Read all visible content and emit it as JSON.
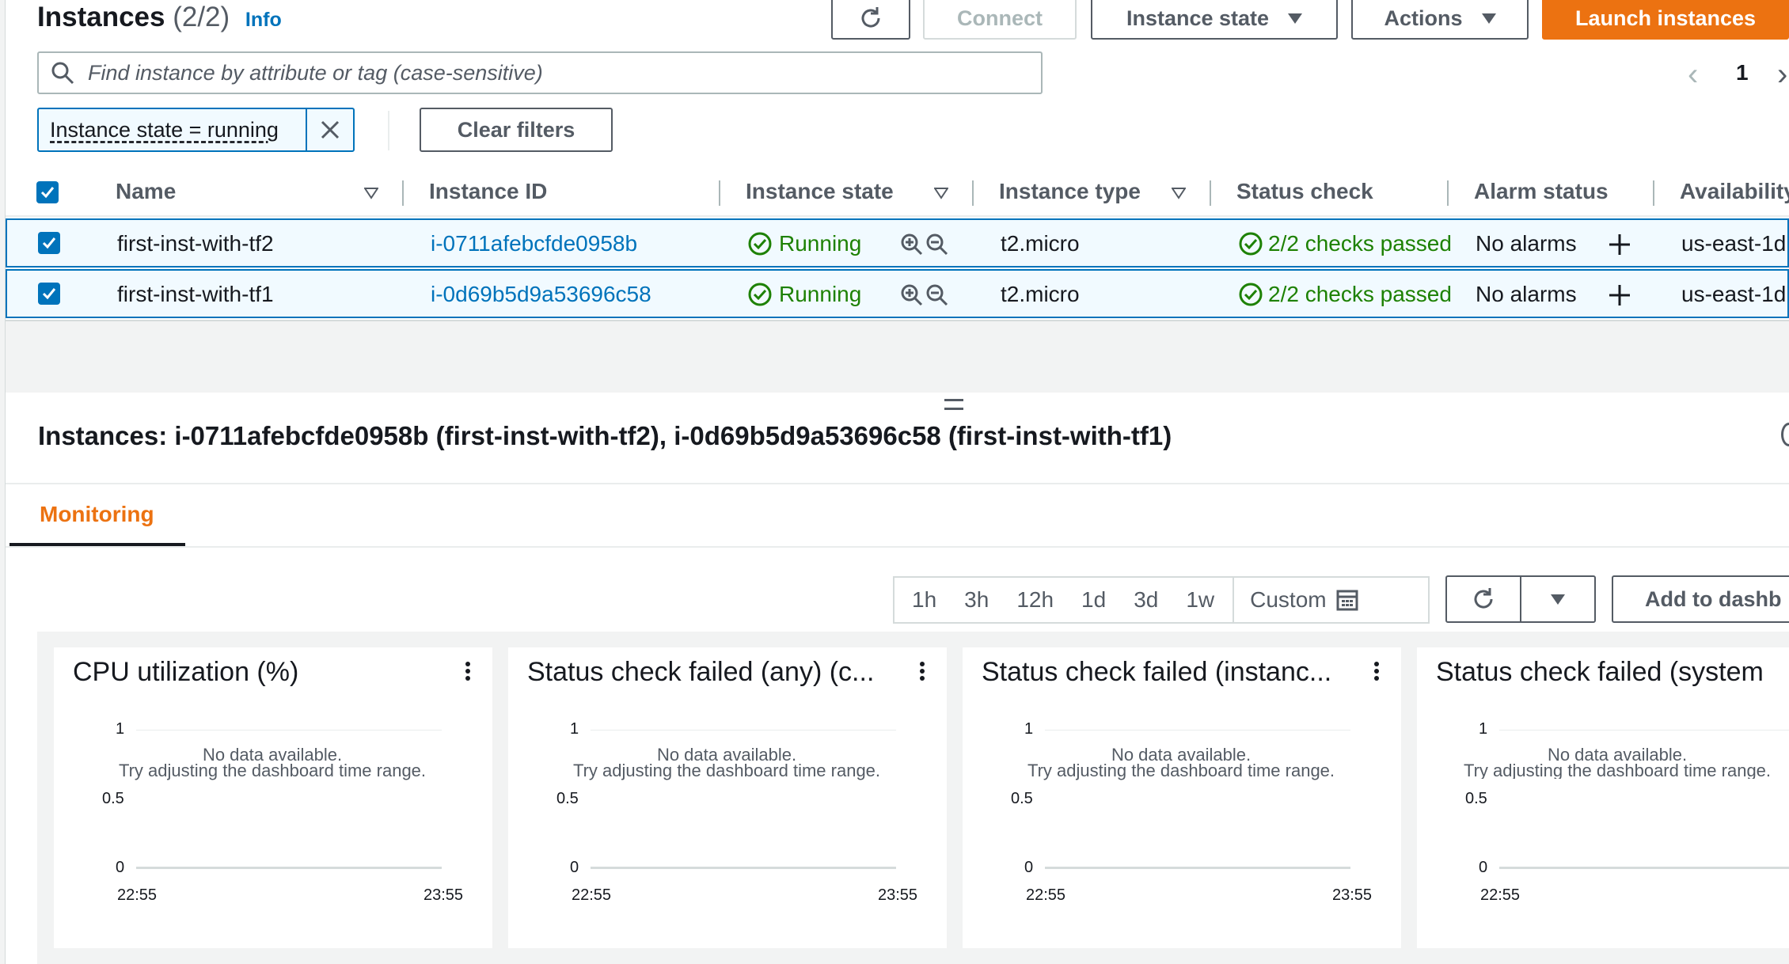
{
  "header": {
    "title": "Instances",
    "count": "(2/2)",
    "info": "Info",
    "refresh_icon": "refresh-icon",
    "connect": "Connect",
    "instance_state": "Instance state",
    "actions": "Actions",
    "launch": "Launch instances"
  },
  "search": {
    "placeholder": "Find instance by attribute or tag (case-sensitive)"
  },
  "pagination": {
    "page": "1"
  },
  "filters": {
    "token": "Instance state = running",
    "clear": "Clear filters"
  },
  "table": {
    "columns": [
      "Name",
      "Instance ID",
      "Instance state",
      "Instance type",
      "Status check",
      "Alarm status",
      "Availability"
    ],
    "rows": [
      {
        "name": "first-inst-with-tf2",
        "id": "i-0711afebcfde0958b",
        "state": "Running",
        "type": "t2.micro",
        "status": "2/2 checks passed",
        "alarm": "No alarms",
        "az": "us-east-1d"
      },
      {
        "name": "first-inst-with-tf1",
        "id": "i-0d69b5d9a53696c58",
        "state": "Running",
        "type": "t2.micro",
        "status": "2/2 checks passed",
        "alarm": "No alarms",
        "az": "us-east-1d"
      }
    ]
  },
  "details": {
    "title": "Instances: i-0711afebcfde0958b (first-inst-with-tf2), i-0d69b5d9a53696c58 (first-inst-with-tf1)",
    "tab": "Monitoring"
  },
  "monitoring": {
    "ranges": [
      "1h",
      "3h",
      "12h",
      "1d",
      "3d",
      "1w"
    ],
    "custom": "Custom",
    "add_dashboard": "Add to dashb",
    "widgets": [
      {
        "title": "CPU utilization (%)"
      },
      {
        "title": "Status check failed (any) (c..."
      },
      {
        "title": "Status check failed (instanc..."
      },
      {
        "title": "Status check failed (system"
      }
    ],
    "nodata_line1": "No data available.",
    "nodata_line2": "Try adjusting the dashboard time range.",
    "y_ticks": [
      "1",
      "0.5",
      "0"
    ],
    "x_start": "22:55",
    "x_end": "23:55"
  },
  "colors": {
    "accent": "#ec7211",
    "link": "#0073bb",
    "success": "#1d8102"
  }
}
